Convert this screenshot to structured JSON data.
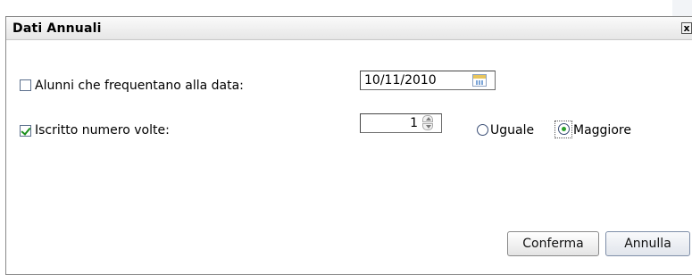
{
  "dialog": {
    "title": "Dati Annuali",
    "close_glyph": "x"
  },
  "form": {
    "alunni": {
      "checked": false,
      "label": "Alunni che frequentano alla data:",
      "date_value": "10/11/2010"
    },
    "iscritto": {
      "checked": true,
      "label": "Iscritto numero volte:",
      "count_value": "1",
      "radio_options": [
        {
          "label": "Uguale",
          "selected": false
        },
        {
          "label": "Maggiore",
          "selected": true
        }
      ]
    }
  },
  "buttons": {
    "confirm_label": "Conferma",
    "cancel_label": "Annulla"
  }
}
